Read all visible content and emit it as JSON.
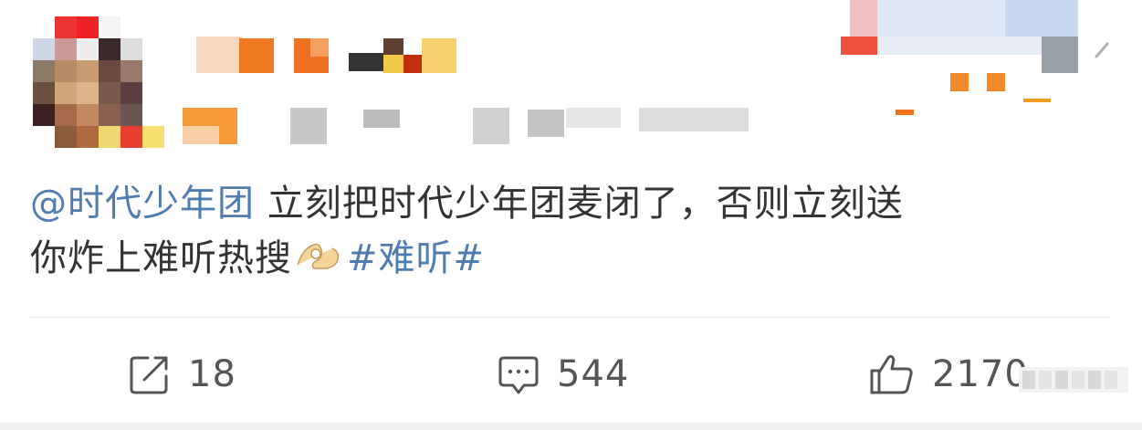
{
  "post": {
    "mention": "@时代少年团",
    "text_line1": " 立刻把时代少年团麦闭了，否则立刻送",
    "text_line2": "你炸上难听热搜",
    "emoji": "ok-hand-emoji",
    "topic": "#难听#"
  },
  "actions": {
    "repost": {
      "icon": "repost-icon",
      "count": "18"
    },
    "comment": {
      "icon": "comment-icon",
      "count": "544"
    },
    "like": {
      "icon": "like-icon",
      "count": "2170"
    }
  },
  "colors": {
    "link": "#507daf",
    "text": "#333333",
    "count": "#555555",
    "divider": "#e9e9e9"
  }
}
